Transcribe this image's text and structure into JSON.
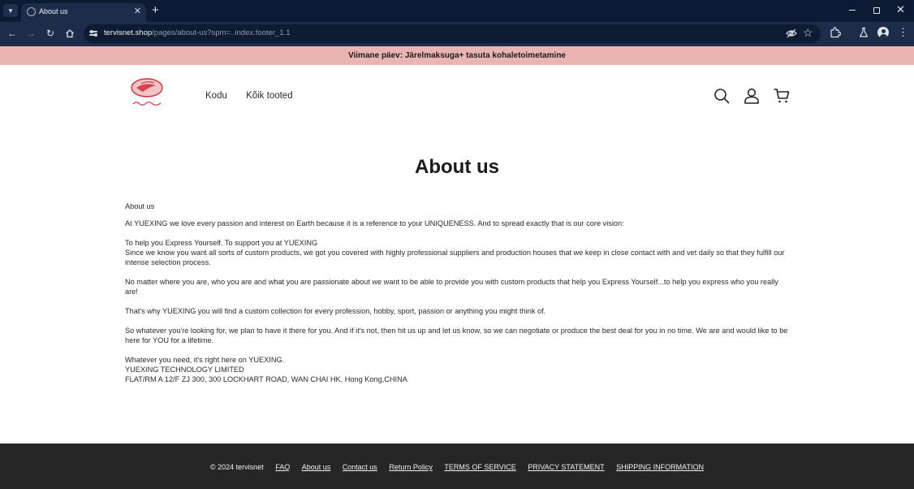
{
  "browser": {
    "tab_title": "About us",
    "url_host": "tervisnet.shop",
    "url_path": "/pages/about-us?spm=..index.footer_1.1"
  },
  "announcement": "Viimane päev: Järelmaksuga+ tasuta kohaletoimetamine",
  "header": {
    "logo_alt": "Tervisnet Shop",
    "nav": [
      "Kodu",
      "Kõik tooted"
    ]
  },
  "page_title": "About us",
  "content": {
    "subtitle": "About us",
    "intro": "At YUEXING we love every passion and interest on Earth because it is a reference to your UNIQUENESS. And to spread exactly that is our core vision:",
    "vision_1": "To help you Express Yourself. To support you at YUEXING",
    "vision_2": "Since we know you want all sorts of custom products, we got you covered with highly professional suppliers and production houses that we keep in close contact with and vet daily so that they fulfill our intense selection process.",
    "p_matter": "No matter where you are, who you are and what you are passionate about we want to be able to provide you with custom products that help you Express Yourself...to help you express who you really are!",
    "p_why": "That's why YUEXING you will find a custom collection for every profession, hobby, sport, passion or anything you might think of.",
    "p_whatever": "So whatever you're looking for, we plan to have it there for you. And if it's not, then hit us up and let us know, so we can negotiate or produce the best deal for you in no time. We are and would like to be here for YOU for a lifetime.",
    "p_need": "Whatever you need, it's right here on YUEXING.",
    "company": "YUEXING TECHNOLOGY LIMITED",
    "address": "FLAT/RM A 12/F ZJ 300, 300 LOCKHART ROAD, WAN CHAI HK, Hong Kong,CHINA"
  },
  "footer": {
    "copyright": "© 2024 tervisnet",
    "links": [
      "FAQ",
      "About us",
      "Contact us",
      "Return Policy",
      "TERMS OF SERVICE",
      "PRIVACY STATEMENT",
      "SHIPPING INFORMATION"
    ]
  }
}
